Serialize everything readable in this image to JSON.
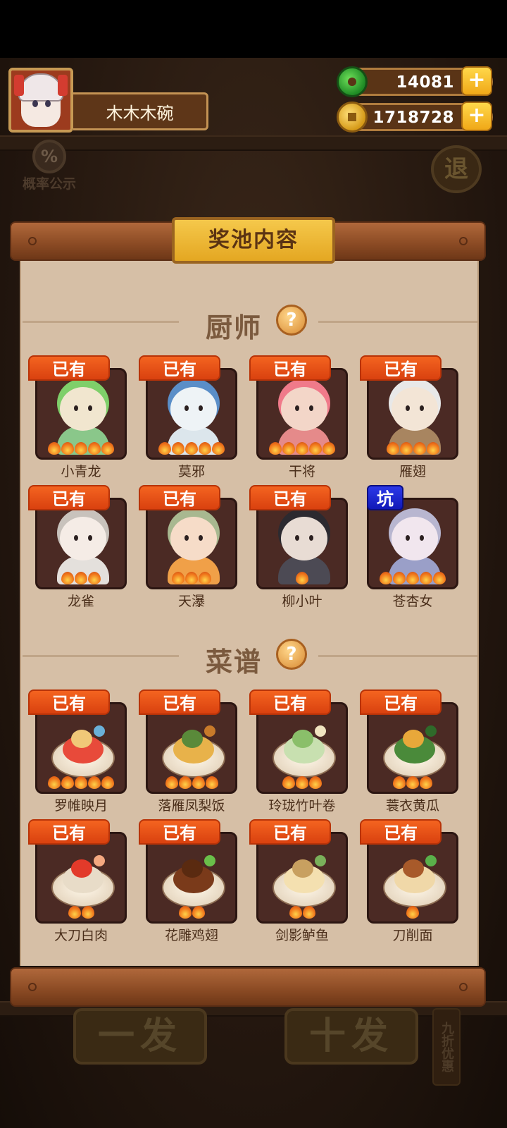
{
  "player": {
    "name": "木木木碗"
  },
  "resources": [
    {
      "icon": "jade-icon",
      "value": "14081"
    },
    {
      "icon": "coin-icon",
      "value": "1718728"
    }
  ],
  "prob_button": {
    "label": "概率公示",
    "icon_text": "%"
  },
  "exit_button": {
    "label": "退"
  },
  "panel": {
    "title": "奖池内容"
  },
  "sections": [
    {
      "title": "厨师",
      "help": "?",
      "items": [
        {
          "badge": "已有",
          "name": "小青龙",
          "stars": 5
        },
        {
          "badge": "已有",
          "name": "莫邪",
          "stars": 5
        },
        {
          "badge": "已有",
          "name": "干将",
          "stars": 5
        },
        {
          "badge": "已有",
          "name": "雁翅",
          "stars": 4
        },
        {
          "badge": "已有",
          "name": "龙雀",
          "stars": 3
        },
        {
          "badge": "已有",
          "name": "天瀑",
          "stars": 3
        },
        {
          "badge": "已有",
          "name": "柳小叶",
          "stars": 1
        },
        {
          "badge": "坑",
          "name": "苍杏女",
          "stars": 5
        }
      ]
    },
    {
      "title": "菜谱",
      "help": "?",
      "items": [
        {
          "badge": "已有",
          "name": "罗帷映月",
          "stars": 5
        },
        {
          "badge": "已有",
          "name": "落雁凤梨饭",
          "stars": 4
        },
        {
          "badge": "已有",
          "name": "玲珑竹叶卷",
          "stars": 3
        },
        {
          "badge": "已有",
          "name": "蓑衣黄瓜",
          "stars": 3
        },
        {
          "badge": "已有",
          "name": "大刀白肉",
          "stars": 2
        },
        {
          "badge": "已有",
          "name": "花雕鸡翅",
          "stars": 2
        },
        {
          "badge": "已有",
          "name": "剑影鲈鱼",
          "stars": 2
        },
        {
          "badge": "已有",
          "name": "刀削面",
          "stars": 1
        }
      ]
    }
  ],
  "bottom": {
    "single_draw": "一发",
    "ten_draw": "十发",
    "discount": "九折优惠"
  },
  "colors": {
    "owned_badge": "#e8521a",
    "pit_badge": "#1b25d0",
    "paper": "#d6bfa6",
    "title_plate": "#f0b834"
  }
}
